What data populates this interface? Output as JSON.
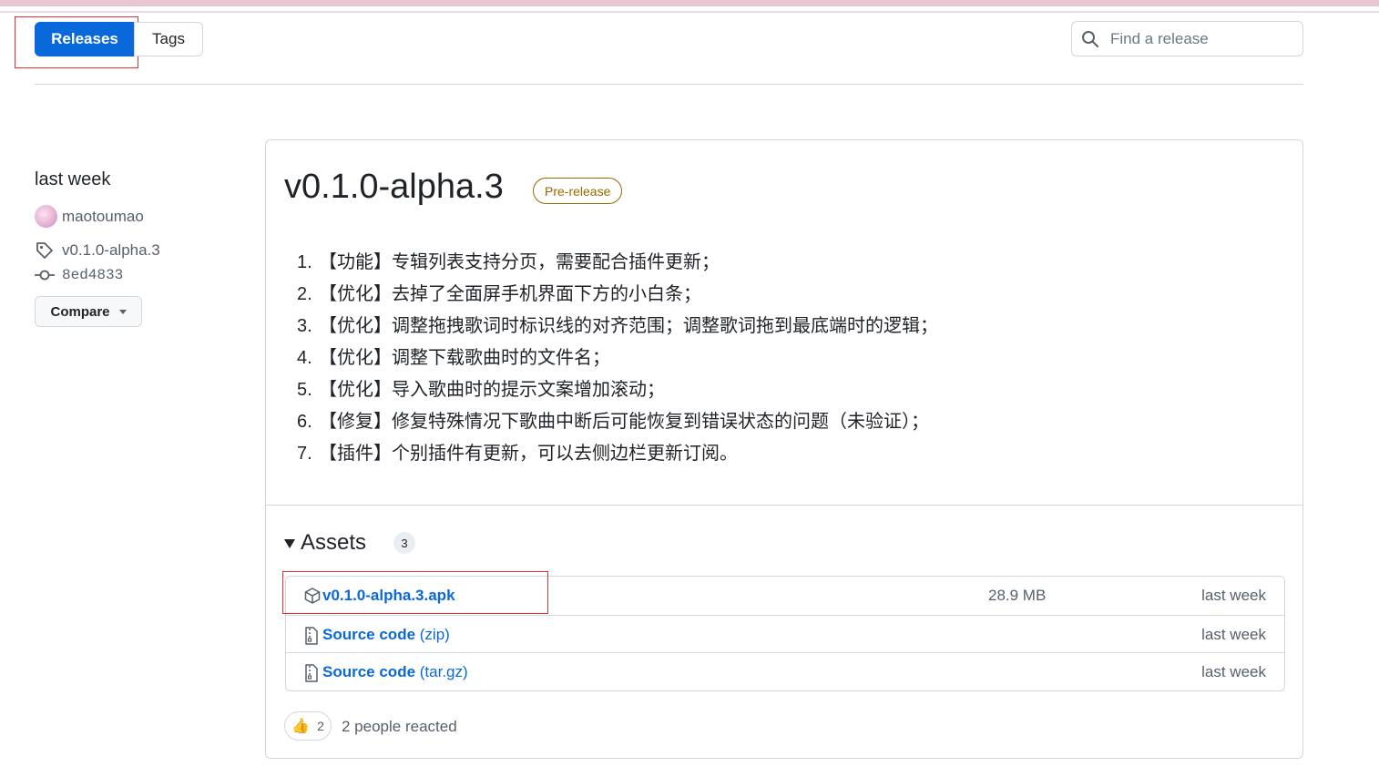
{
  "tabs": {
    "releases_label": "Releases",
    "tags_label": "Tags"
  },
  "search": {
    "placeholder": "Find a release"
  },
  "sidebar": {
    "date": "last week",
    "author": "maotoumao",
    "tag": "v0.1.0-alpha.3",
    "commit": "8ed4833",
    "compare_label": "Compare"
  },
  "release": {
    "title": "v0.1.0-alpha.3",
    "badge": "Pre-release",
    "notes": [
      {
        "num": "1.",
        "text": "【功能】专辑列表支持分页，需要配合插件更新；"
      },
      {
        "num": "2.",
        "text": "【优化】去掉了全面屏手机界面下方的小白条；"
      },
      {
        "num": "3.",
        "text": "【优化】调整拖拽歌词时标识线的对齐范围；调整歌词拖到最底端时的逻辑；"
      },
      {
        "num": "4.",
        "text": "【优化】调整下载歌曲时的文件名；"
      },
      {
        "num": "5.",
        "text": "【优化】导入歌曲时的提示文案增加滚动；"
      },
      {
        "num": "6.",
        "text": "【修复】修复特殊情况下歌曲中断后可能恢复到错误状态的问题（未验证）；"
      },
      {
        "num": "7.",
        "text": "【插件】个别插件有更新，可以去侧边栏更新订阅。"
      }
    ]
  },
  "assets": {
    "title": "Assets",
    "count": "3",
    "items": [
      {
        "name": "v0.1.0-alpha.3.apk",
        "suffix": "",
        "size": "28.9 MB",
        "date": "last week",
        "icon": "package-icon"
      },
      {
        "name": "Source code",
        "suffix": " (zip)",
        "size": "",
        "date": "last week",
        "icon": "file-zip-icon"
      },
      {
        "name": "Source code",
        "suffix": " (tar.gz)",
        "size": "",
        "date": "last week",
        "icon": "file-zip-icon"
      }
    ]
  },
  "reactions": {
    "emoji": "👍",
    "count": "2",
    "summary": "2 people reacted"
  },
  "colors": {
    "accent": "#0969da",
    "prerelease": "#9a6700",
    "highlight": "#e03131"
  }
}
